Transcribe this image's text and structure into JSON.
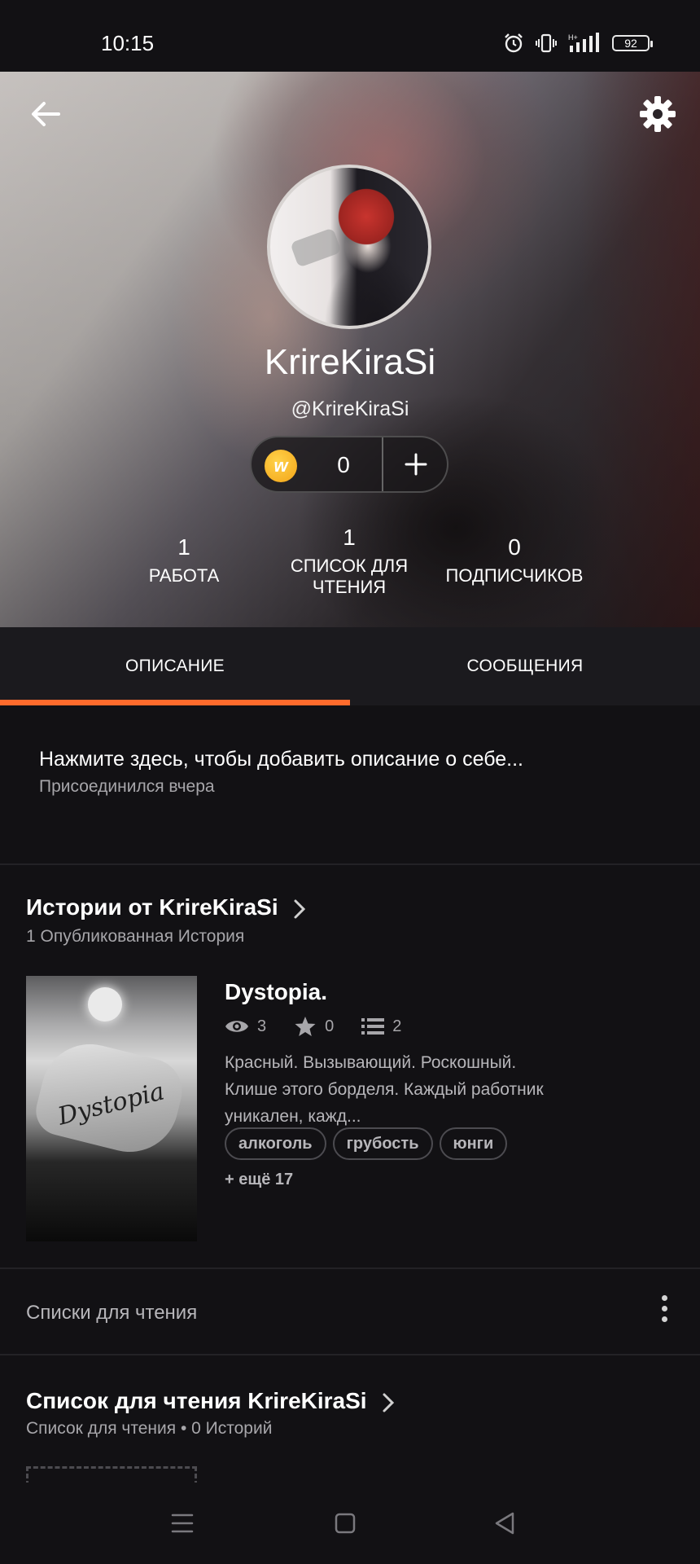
{
  "status_bar": {
    "time": "10:15",
    "battery": "92"
  },
  "profile": {
    "username": "KrireKiraSi",
    "handle": "@KrireKiraSi",
    "coins": "0",
    "stats": [
      {
        "value": "1",
        "label": "РАБОТА"
      },
      {
        "value": "1",
        "label": "СПИСОК ДЛЯ ЧТЕНИЯ"
      },
      {
        "value": "0",
        "label": "ПОДПИСЧИКОВ"
      }
    ]
  },
  "tabs": {
    "about": "ОПИСАНИЕ",
    "messages": "СООБЩЕНИЯ",
    "active_color": "#ff6b2c"
  },
  "about": {
    "prompt": "Нажмите здесь, чтобы добавить описание о себе...",
    "joined": "Присоединился вчера"
  },
  "stories": {
    "title": "Истории от KrireKiraSi",
    "subtitle": "1 Опубликованная История",
    "book": {
      "cover_text": "Dystopia",
      "title": "Dystopia.",
      "reads": "3",
      "votes": "0",
      "parts": "2",
      "description": "Красный. Вызывающий. Роскошный. Клише этого борделя. Каждый работник уникален, кажд...",
      "tags": [
        "алкоголь",
        "грубость",
        "юнги"
      ],
      "more_tags": "+ ещё 17"
    }
  },
  "reading_lists": {
    "label": "Списки для чтения",
    "list_title": "Список для чтения KrireKiraSi",
    "list_subtitle": "Список для чтения • 0 Историй"
  }
}
